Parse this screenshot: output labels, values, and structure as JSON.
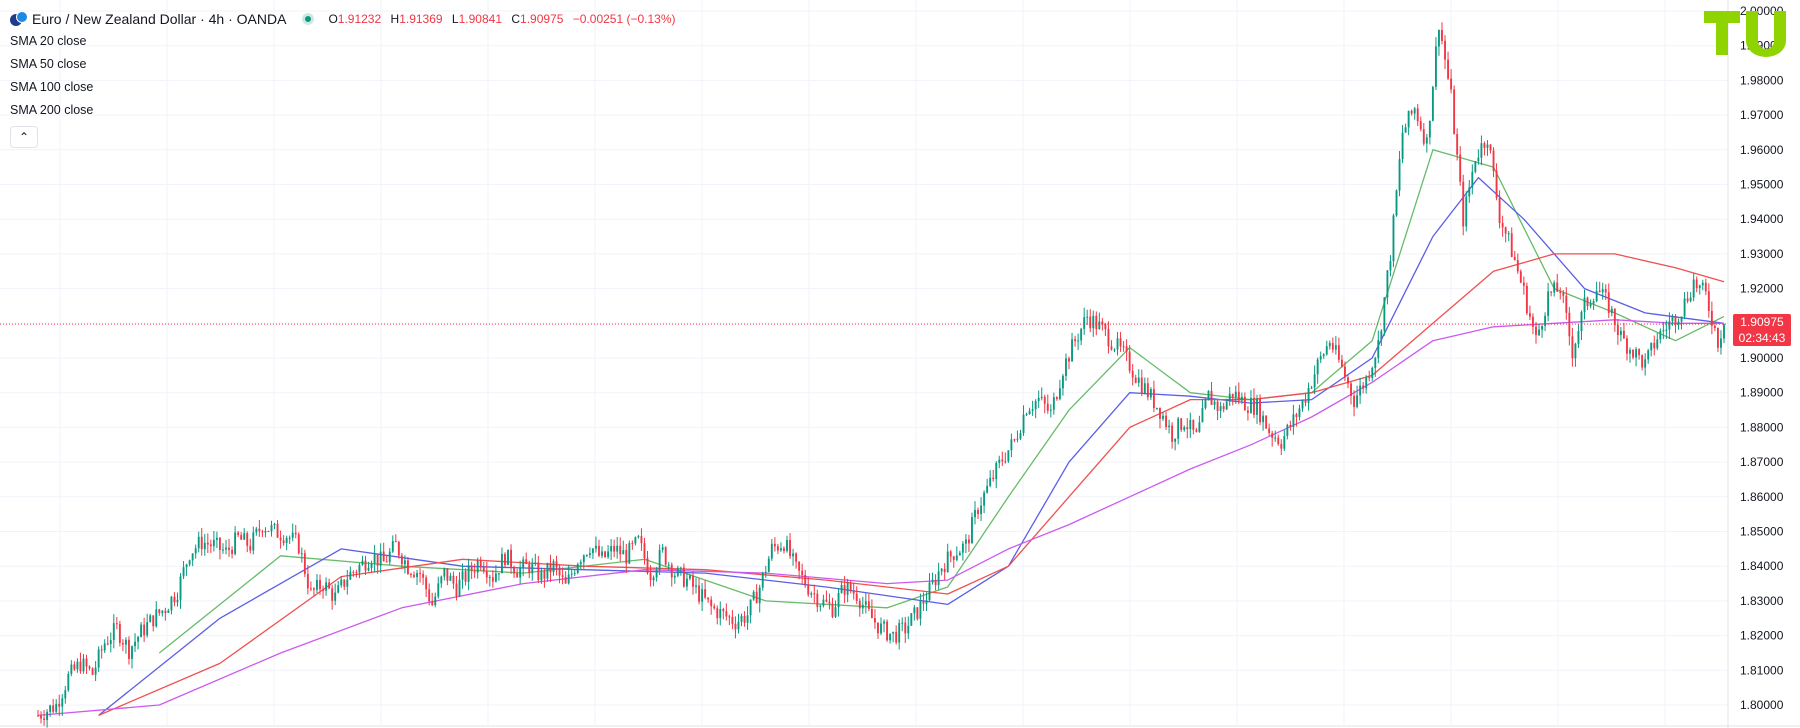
{
  "header": {
    "title": "Euro / New Zealand Dollar · 4h · OANDA",
    "ohlc": {
      "open_label": "O",
      "open": "1.91232",
      "high_label": "H",
      "high": "1.91369",
      "low_label": "L",
      "low": "1.90841",
      "close_label": "C",
      "close": "1.90975",
      "change": "−0.00251 (−0.13%)"
    },
    "status_color": "#089981"
  },
  "indicators": [
    {
      "label": "SMA 20 close",
      "color": "#66bb6a"
    },
    {
      "label": "SMA 50 close",
      "color": "#5b5ee6"
    },
    {
      "label": "SMA 100 close",
      "color": "#f05050"
    },
    {
      "label": "SMA 200 close",
      "color": "#cc5af0"
    }
  ],
  "collapse_icon": "chevron-up-icon",
  "price_tag": {
    "price": "1.90975",
    "countdown": "02:34:43",
    "color": "#f23645"
  },
  "logo_icon": "tu-logo",
  "colors": {
    "up": "#089981",
    "down": "#f23645",
    "grid": "#f0f3fa",
    "last_price_line": "#f23645"
  },
  "chart_data": {
    "type": "candlestick",
    "symbol": "EURNZD",
    "timeframe": "4h",
    "y_ticks": [
      "1.80000",
      "1.81000",
      "1.82000",
      "1.83000",
      "1.84000",
      "1.85000",
      "1.86000",
      "1.87000",
      "1.88000",
      "1.89000",
      "1.90000",
      "1.91000",
      "1.92000",
      "1.93000",
      "1.94000",
      "1.95000",
      "1.96000",
      "1.97000",
      "1.98000",
      "1.99000",
      "2.00000"
    ],
    "ylim": [
      1.797,
      2.001
    ],
    "last_price": 1.90975,
    "close_path": [
      [
        0,
        1.797
      ],
      [
        6,
        1.8
      ],
      [
        10,
        1.808
      ],
      [
        14,
        1.812
      ],
      [
        18,
        1.809
      ],
      [
        22,
        1.818
      ],
      [
        26,
        1.822
      ],
      [
        30,
        1.816
      ],
      [
        34,
        1.821
      ],
      [
        38,
        1.825
      ],
      [
        42,
        1.828
      ],
      [
        46,
        1.833
      ],
      [
        50,
        1.844
      ],
      [
        54,
        1.847
      ],
      [
        58,
        1.846
      ],
      [
        62,
        1.844
      ],
      [
        66,
        1.848
      ],
      [
        70,
        1.846
      ],
      [
        74,
        1.852
      ],
      [
        78,
        1.85
      ],
      [
        82,
        1.849
      ],
      [
        86,
        1.846
      ],
      [
        90,
        1.832
      ],
      [
        94,
        1.835
      ],
      [
        98,
        1.831
      ],
      [
        102,
        1.837
      ],
      [
        106,
        1.84
      ],
      [
        110,
        1.843
      ],
      [
        114,
        1.841
      ],
      [
        118,
        1.846
      ],
      [
        122,
        1.84
      ],
      [
        126,
        1.838
      ],
      [
        130,
        1.829
      ],
      [
        134,
        1.838
      ],
      [
        138,
        1.834
      ],
      [
        142,
        1.838
      ],
      [
        146,
        1.842
      ],
      [
        150,
        1.837
      ],
      [
        154,
        1.843
      ],
      [
        158,
        1.839
      ],
      [
        162,
        1.84
      ],
      [
        166,
        1.837
      ],
      [
        170,
        1.84
      ],
      [
        174,
        1.834
      ],
      [
        178,
        1.842
      ],
      [
        182,
        1.846
      ],
      [
        186,
        1.842
      ],
      [
        190,
        1.845
      ],
      [
        194,
        1.843
      ],
      [
        198,
        1.847
      ],
      [
        202,
        1.838
      ],
      [
        206,
        1.844
      ],
      [
        210,
        1.838
      ],
      [
        214,
        1.836
      ],
      [
        218,
        1.832
      ],
      [
        222,
        1.828
      ],
      [
        226,
        1.826
      ],
      [
        230,
        1.824
      ],
      [
        234,
        1.826
      ],
      [
        238,
        1.834
      ],
      [
        242,
        1.845
      ],
      [
        246,
        1.847
      ],
      [
        250,
        1.839
      ],
      [
        254,
        1.834
      ],
      [
        258,
        1.83
      ],
      [
        262,
        1.828
      ],
      [
        266,
        1.834
      ],
      [
        270,
        1.832
      ],
      [
        274,
        1.826
      ],
      [
        278,
        1.822
      ],
      [
        282,
        1.82
      ],
      [
        286,
        1.822
      ],
      [
        290,
        1.827
      ],
      [
        294,
        1.833
      ],
      [
        298,
        1.84
      ],
      [
        302,
        1.844
      ],
      [
        306,
        1.846
      ],
      [
        310,
        1.857
      ],
      [
        314,
        1.864
      ],
      [
        318,
        1.871
      ],
      [
        322,
        1.876
      ],
      [
        326,
        1.886
      ],
      [
        330,
        1.888
      ],
      [
        334,
        1.884
      ],
      [
        338,
        1.897
      ],
      [
        342,
        1.905
      ],
      [
        346,
        1.912
      ],
      [
        350,
        1.909
      ],
      [
        354,
        1.905
      ],
      [
        358,
        1.901
      ],
      [
        362,
        1.895
      ],
      [
        366,
        1.89
      ],
      [
        370,
        1.885
      ],
      [
        374,
        1.878
      ],
      [
        378,
        1.882
      ],
      [
        382,
        1.877
      ],
      [
        386,
        1.889
      ],
      [
        390,
        1.885
      ],
      [
        394,
        1.89
      ],
      [
        398,
        1.887
      ],
      [
        402,
        1.886
      ],
      [
        406,
        1.879
      ],
      [
        410,
        1.876
      ],
      [
        414,
        1.882
      ],
      [
        418,
        1.889
      ],
      [
        422,
        1.898
      ],
      [
        426,
        1.905
      ],
      [
        430,
        1.897
      ],
      [
        434,
        1.888
      ],
      [
        438,
        1.894
      ],
      [
        442,
        1.904
      ],
      [
        446,
        1.93
      ],
      [
        450,
        1.965
      ],
      [
        454,
        1.972
      ],
      [
        458,
        1.962
      ],
      [
        462,
        1.997
      ],
      [
        466,
        1.975
      ],
      [
        470,
        1.94
      ],
      [
        474,
        1.958
      ],
      [
        478,
        1.964
      ],
      [
        482,
        1.941
      ],
      [
        486,
        1.931
      ],
      [
        490,
        1.919
      ],
      [
        494,
        1.905
      ],
      [
        498,
        1.918
      ],
      [
        502,
        1.92
      ],
      [
        506,
        1.902
      ],
      [
        510,
        1.915
      ],
      [
        514,
        1.92
      ],
      [
        518,
        1.915
      ],
      [
        522,
        1.906
      ],
      [
        526,
        1.902
      ],
      [
        530,
        1.898
      ],
      [
        534,
        1.906
      ],
      [
        538,
        1.91
      ],
      [
        542,
        1.914
      ],
      [
        546,
        1.922
      ],
      [
        550,
        1.918
      ],
      [
        554,
        1.905
      ],
      [
        556,
        1.90975
      ]
    ],
    "sma": {
      "sma20": [
        [
          40,
          1.815
        ],
        [
          80,
          1.843
        ],
        [
          120,
          1.84
        ],
        [
          160,
          1.838
        ],
        [
          200,
          1.842
        ],
        [
          240,
          1.83
        ],
        [
          280,
          1.828
        ],
        [
          300,
          1.834
        ],
        [
          320,
          1.86
        ],
        [
          340,
          1.885
        ],
        [
          360,
          1.903
        ],
        [
          380,
          1.89
        ],
        [
          400,
          1.888
        ],
        [
          420,
          1.89
        ],
        [
          440,
          1.905
        ],
        [
          460,
          1.96
        ],
        [
          480,
          1.955
        ],
        [
          500,
          1.92
        ],
        [
          520,
          1.913
        ],
        [
          540,
          1.905
        ],
        [
          556,
          1.912
        ]
      ],
      "sma50": [
        [
          20,
          1.797
        ],
        [
          60,
          1.825
        ],
        [
          100,
          1.845
        ],
        [
          140,
          1.84
        ],
        [
          180,
          1.839
        ],
        [
          220,
          1.838
        ],
        [
          260,
          1.834
        ],
        [
          300,
          1.829
        ],
        [
          320,
          1.84
        ],
        [
          340,
          1.87
        ],
        [
          360,
          1.89
        ],
        [
          380,
          1.889
        ],
        [
          400,
          1.887
        ],
        [
          420,
          1.888
        ],
        [
          440,
          1.9
        ],
        [
          460,
          1.935
        ],
        [
          475,
          1.952
        ],
        [
          490,
          1.94
        ],
        [
          510,
          1.92
        ],
        [
          530,
          1.913
        ],
        [
          556,
          1.91
        ]
      ],
      "sma100": [
        [
          20,
          1.797
        ],
        [
          60,
          1.812
        ],
        [
          100,
          1.837
        ],
        [
          140,
          1.842
        ],
        [
          180,
          1.84
        ],
        [
          220,
          1.839
        ],
        [
          260,
          1.836
        ],
        [
          300,
          1.832
        ],
        [
          320,
          1.84
        ],
        [
          340,
          1.86
        ],
        [
          360,
          1.88
        ],
        [
          380,
          1.888
        ],
        [
          400,
          1.888
        ],
        [
          420,
          1.89
        ],
        [
          440,
          1.895
        ],
        [
          460,
          1.91
        ],
        [
          480,
          1.925
        ],
        [
          500,
          1.93
        ],
        [
          520,
          1.93
        ],
        [
          540,
          1.926
        ],
        [
          556,
          1.922
        ]
      ],
      "sma200": [
        [
          0,
          1.797
        ],
        [
          40,
          1.8
        ],
        [
          80,
          1.815
        ],
        [
          120,
          1.828
        ],
        [
          160,
          1.835
        ],
        [
          200,
          1.839
        ],
        [
          240,
          1.838
        ],
        [
          280,
          1.835
        ],
        [
          300,
          1.836
        ],
        [
          320,
          1.845
        ],
        [
          340,
          1.852
        ],
        [
          360,
          1.86
        ],
        [
          380,
          1.868
        ],
        [
          400,
          1.875
        ],
        [
          420,
          1.883
        ],
        [
          440,
          1.893
        ],
        [
          460,
          1.905
        ],
        [
          480,
          1.909
        ],
        [
          500,
          1.91
        ],
        [
          520,
          1.911
        ],
        [
          540,
          1.91
        ],
        [
          556,
          1.91
        ]
      ]
    }
  }
}
